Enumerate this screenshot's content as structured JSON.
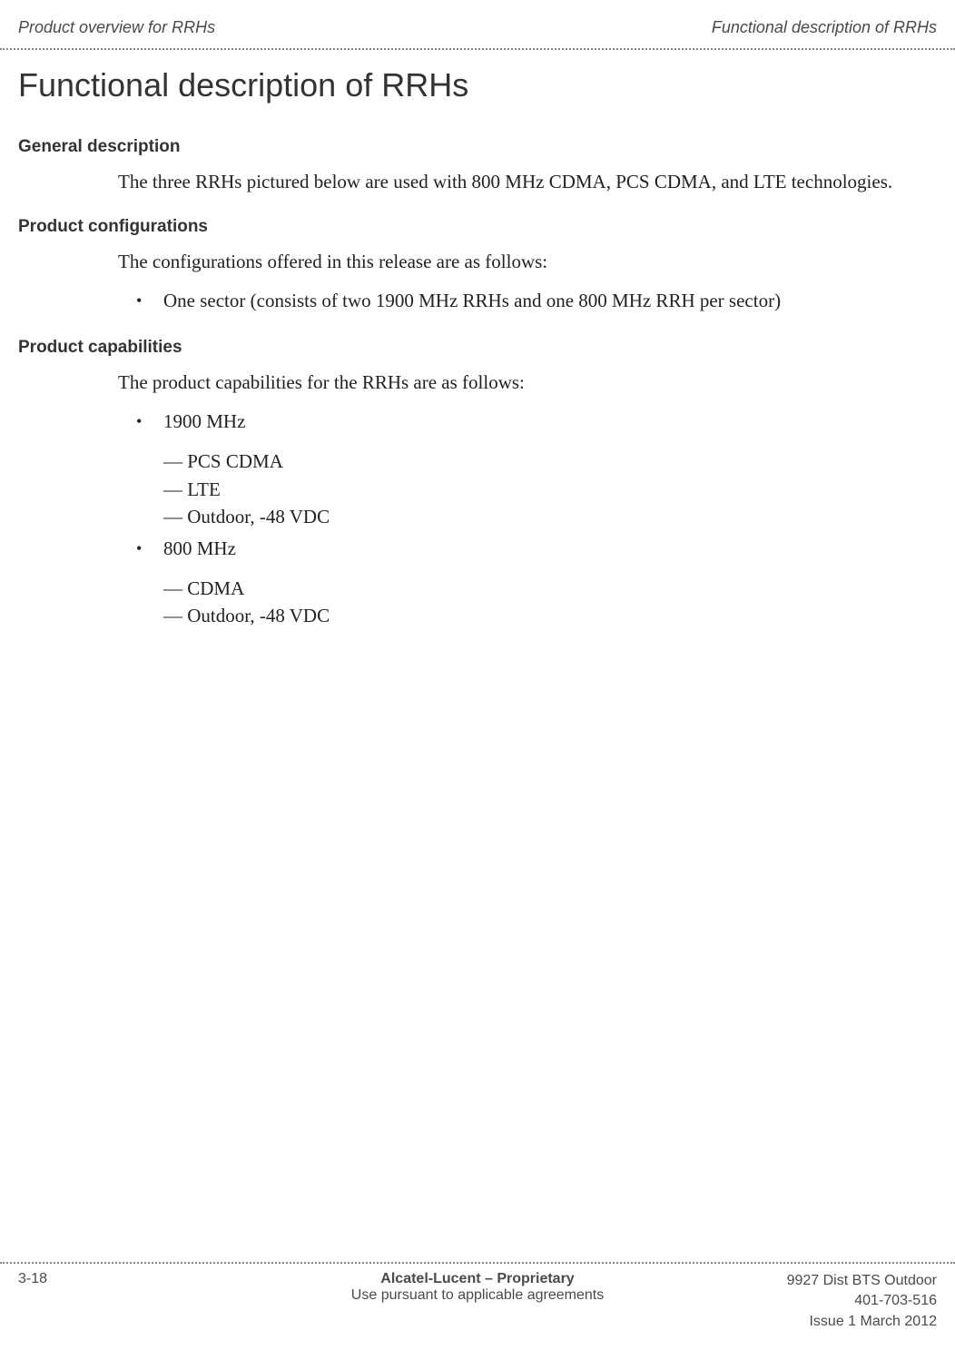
{
  "header": {
    "left": "Product overview for RRHs",
    "right": "Functional description of RRHs"
  },
  "title": "Functional description of RRHs",
  "sections": {
    "general": {
      "heading": "General description",
      "body": "The three RRHs pictured below are used with 800 MHz CDMA, PCS CDMA, and LTE technologies."
    },
    "config": {
      "heading": "Product configurations",
      "body": "The configurations offered in this release are as follows:",
      "bullets": [
        "One sector (consists of two 1900 MHz RRHs and one 800 MHz RRH per sector)"
      ]
    },
    "capabilities": {
      "heading": "Product capabilities",
      "body": "The product capabilities for the RRHs are as follows:",
      "items": [
        {
          "label": "1900 MHz",
          "subs": [
            "— PCS CDMA",
            "— LTE",
            "— Outdoor, -48 VDC"
          ]
        },
        {
          "label": "800 MHz",
          "subs": [
            "— CDMA",
            "— Outdoor, -48 VDC"
          ]
        }
      ]
    }
  },
  "footer": {
    "pageNum": "3-18",
    "centerLine1": "Alcatel-Lucent – Proprietary",
    "centerLine2": "Use pursuant to applicable agreements",
    "rightLine1": "9927 Dist BTS Outdoor",
    "rightLine2": "401-703-516",
    "rightLine3": "Issue 1   March 2012"
  }
}
